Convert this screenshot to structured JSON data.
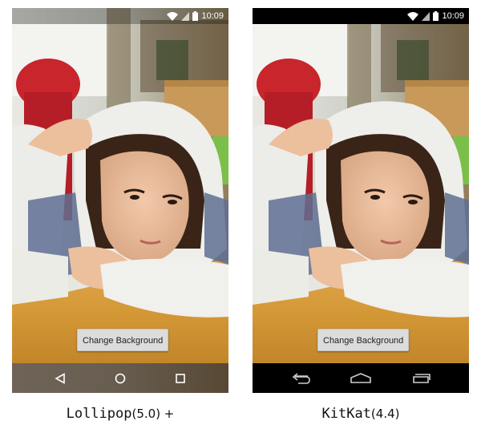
{
  "phones": [
    {
      "id": "lollipop",
      "status_time": "10:09",
      "button_label": "Change Background",
      "nav_icons": [
        "back-triangle-icon",
        "home-circle-icon",
        "recents-square-icon"
      ],
      "caption_name": "Lollipop",
      "caption_version": "(5.0) +"
    },
    {
      "id": "kitkat",
      "status_time": "10:09",
      "button_label": "Change Background",
      "nav_icons": [
        "back-arrow-icon",
        "home-house-icon",
        "recents-stack-icon"
      ],
      "caption_name": "KitKat",
      "caption_version": "(4.4)"
    }
  ],
  "colors": {
    "lollipop_navbar": "#46372880",
    "kitkat_navbar": "#000000",
    "button_bg": "#dcdcdc",
    "wall_light": "#f1f1ee",
    "table_wood": "#d79d44",
    "hoodie": "#ebebe6",
    "chair_red": "#c8252c"
  }
}
